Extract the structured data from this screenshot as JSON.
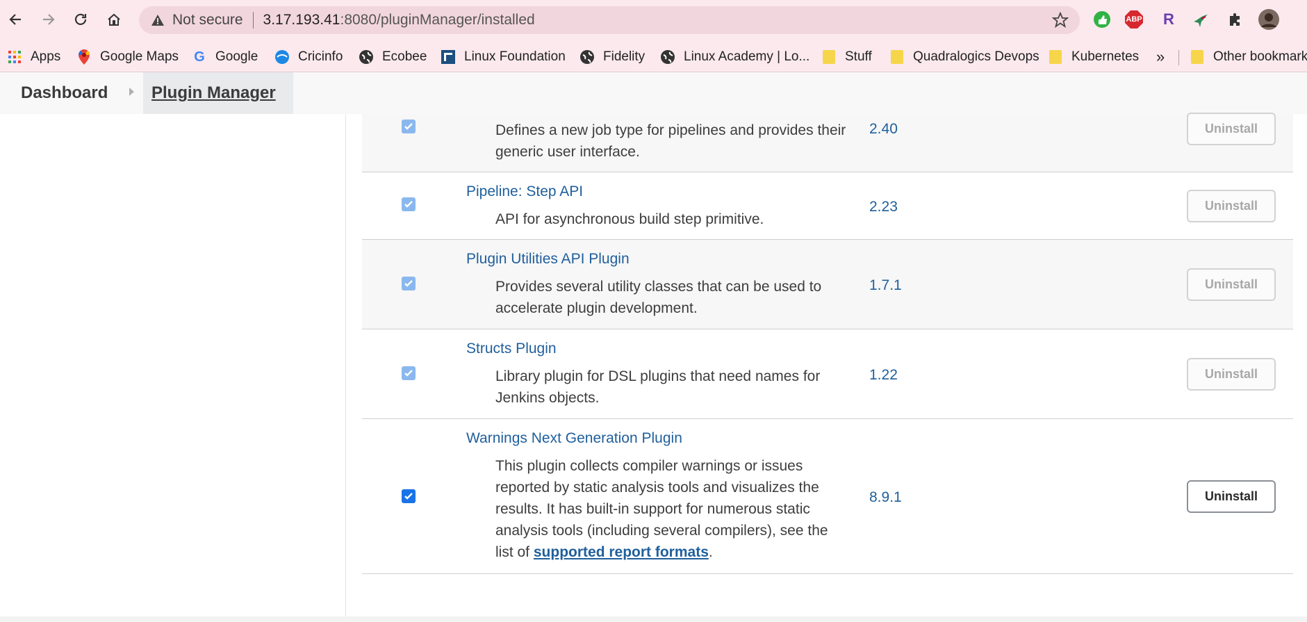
{
  "browser": {
    "not_secure_label": "Not secure",
    "url_host": "3.17.193.41",
    "url_rest": ":8080/pluginManager/installed",
    "extensions": [
      "green-thumb-icon",
      "adblock-icon",
      "r-extension-icon",
      "bird-extension-icon",
      "puzzle-icon",
      "profile-avatar"
    ],
    "ext_abp_label": "ABP",
    "ext_r_label": "R"
  },
  "bookmarks": {
    "items": [
      {
        "label": "Apps",
        "icon": "apps-grid-icon"
      },
      {
        "label": "Google Maps",
        "icon": "maps-pin-icon"
      },
      {
        "label": "Google",
        "icon": "google-g-icon"
      },
      {
        "label": "Cricinfo",
        "icon": "cricinfo-icon"
      },
      {
        "label": "Ecobee",
        "icon": "globe-icon"
      },
      {
        "label": "Linux Foundation",
        "icon": "linux-foundation-icon"
      },
      {
        "label": "Fidelity",
        "icon": "globe-icon"
      },
      {
        "label": "Linux Academy | Lo...",
        "icon": "globe-icon"
      },
      {
        "label": "Stuff",
        "icon": "folder-icon"
      },
      {
        "label": "Quadralogics Devops",
        "icon": "folder-icon"
      },
      {
        "label": "Kubernetes",
        "icon": "folder-icon"
      }
    ],
    "overflow_label": "»",
    "other_label": "Other bookmarks"
  },
  "breadcrumb": {
    "dashboard": "Dashboard",
    "current": "Plugin Manager"
  },
  "plugins": [
    {
      "name": "",
      "desc": "Defines a new job type for pipelines and provides their generic user interface.",
      "version": "2.40",
      "checked": true,
      "enabled_uninstall": false
    },
    {
      "name": "Pipeline: Step API",
      "desc": "API for asynchronous build step primitive.",
      "version": "2.23",
      "checked": true,
      "enabled_uninstall": false
    },
    {
      "name": "Plugin Utilities API Plugin",
      "desc": "Provides several utility classes that can be used to accelerate plugin development.",
      "version": "1.7.1",
      "checked": true,
      "enabled_uninstall": false
    },
    {
      "name": "Structs Plugin",
      "desc": "Library plugin for DSL plugins that need names for Jenkins objects.",
      "version": "1.22",
      "checked": true,
      "enabled_uninstall": false
    },
    {
      "name": "Warnings Next Generation Plugin",
      "desc": "This plugin collects compiler warnings or issues reported by static analysis tools and visualizes the results. It has built-in support for numerous static analysis tools (including several compilers), see the list of",
      "desc_link": "supported report formats",
      "desc_end": ".",
      "version": "8.9.1",
      "checked": true,
      "enabled_uninstall": true
    }
  ],
  "uninstall_label": "Uninstall",
  "colors": {
    "accent": "#1f5f9c",
    "checkbox": "#1a73e8",
    "chrome": "#fbe9ee"
  }
}
